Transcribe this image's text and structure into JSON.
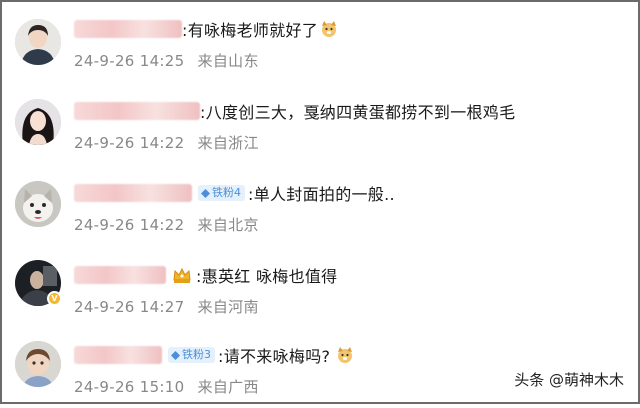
{
  "comments": [
    {
      "text": ":有咏梅老师就好了",
      "date": "24-9-26",
      "time": "14:25",
      "location": "来自山东",
      "badge": ""
    },
    {
      "text": ":八度创三大，戛纳四黄蛋都捞不到一根鸡毛",
      "date": "24-9-26",
      "time": "14:22",
      "location": "来自浙江",
      "badge": ""
    },
    {
      "text": ":单人封面拍的一般..",
      "date": "24-9-26",
      "time": "14:22",
      "location": "来自北京",
      "badge": "铁粉4"
    },
    {
      "text": ":惠英红 咏梅也值得",
      "date": "24-9-26",
      "time": "14:27",
      "location": "来自河南",
      "badge": ""
    },
    {
      "text": ":请不来咏梅吗?",
      "date": "24-9-26",
      "time": "15:10",
      "location": "来自广西",
      "badge": "铁粉3"
    }
  ],
  "watermark": "头条 @萌神木木",
  "colors": {
    "text": "#1a1a1a",
    "meta": "#888888",
    "fan_badge_bg": "#e4f0fb",
    "fan_badge_text": "#4c8fd8",
    "frame": "#6b6b6b"
  },
  "icons": [
    "dog-emoji-icon",
    "diamond-icon",
    "crown-icon",
    "verified-badge-icon"
  ]
}
